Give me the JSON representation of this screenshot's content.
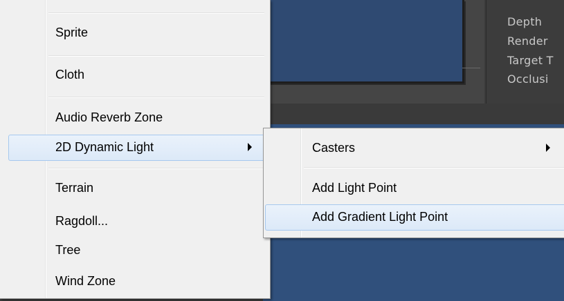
{
  "inspector": {
    "rows": [
      "Depth",
      "Render",
      "Target T",
      "Occlusi"
    ]
  },
  "menu": {
    "items": [
      {
        "label": "Sprite"
      },
      {
        "label": "Cloth"
      },
      {
        "label": "Audio Reverb Zone"
      },
      {
        "label": "2D Dynamic Light",
        "has_submenu": true,
        "highlighted": true
      },
      {
        "label": "Terrain"
      },
      {
        "label": "Ragdoll..."
      },
      {
        "label": "Tree"
      },
      {
        "label": "Wind Zone"
      }
    ]
  },
  "submenu": {
    "items": [
      {
        "label": "Casters",
        "has_submenu": true
      },
      {
        "label": "Add Light Point"
      },
      {
        "label": "Add Gradient Light Point",
        "highlighted": true
      }
    ]
  },
  "colors": {
    "menu_bg": "#f0f0f0",
    "highlight_border": "#a6c8ee",
    "scene_blue": "#2f4a72",
    "editor_dark": "#3b3b3b"
  },
  "icons": [
    "submenu-arrow-icon"
  ]
}
